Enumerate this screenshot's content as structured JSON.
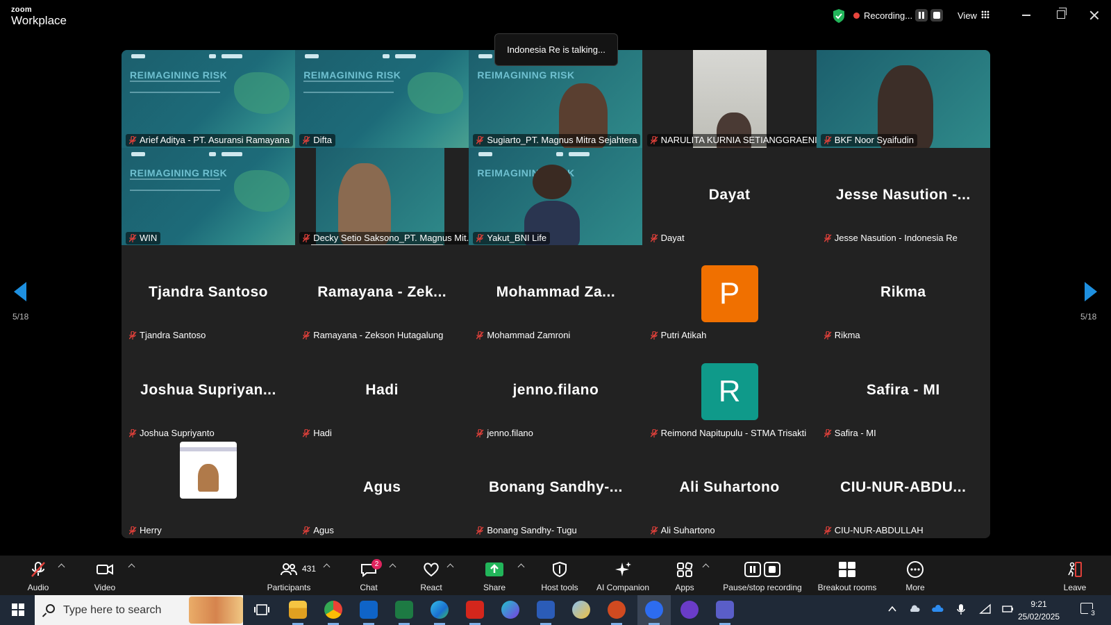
{
  "app": {
    "brand_top": "zoom",
    "brand_bottom": "Workplace"
  },
  "recording": {
    "label": "Recording..."
  },
  "view": {
    "label": "View"
  },
  "talking": "Indonesia Re is talking...",
  "nav": {
    "page": "5/18"
  },
  "slide": {
    "title": "REIMAGINING RISK"
  },
  "participants": [
    {
      "name": "Arief Aditya - PT. Asuransi Ramayana",
      "type": "slide"
    },
    {
      "name": "Difta",
      "type": "slide"
    },
    {
      "name": "Sugiarto_PT. Magnus Mitra Sejahtera",
      "type": "video"
    },
    {
      "name": "NARULITA KURNIA SETIANGGRAENI",
      "type": "video"
    },
    {
      "name": "BKF Noor Syaifudin",
      "type": "video"
    },
    {
      "name": "WIN",
      "type": "slide"
    },
    {
      "name": "Decky Setio Saksono_PT. Magnus Mit...",
      "type": "video",
      "active": true
    },
    {
      "name": "Yakut_BNI Life",
      "type": "video"
    },
    {
      "name": "Dayat",
      "display": "Dayat",
      "type": "name"
    },
    {
      "name": "Jesse Nasution - Indonesia Re",
      "display": "Jesse Nasution -...",
      "type": "name"
    },
    {
      "name": "Tjandra Santoso",
      "display": "Tjandra Santoso",
      "type": "name"
    },
    {
      "name": "Ramayana - Zekson Hutagalung",
      "display": "Ramayana - Zek...",
      "type": "name"
    },
    {
      "name": "Mohammad Zamroni",
      "display": "Mohammad Za...",
      "type": "name"
    },
    {
      "name": "Putri Atikah",
      "initial": "P",
      "color": "#f07000",
      "type": "avatar"
    },
    {
      "name": "Rikma",
      "display": "Rikma",
      "type": "name"
    },
    {
      "name": "Joshua Supriyanto",
      "display": "Joshua Supriyan...",
      "type": "name"
    },
    {
      "name": "Hadi",
      "display": "Hadi",
      "type": "name"
    },
    {
      "name": "jenno.filano",
      "display": "jenno.filano",
      "type": "name"
    },
    {
      "name": "Reimond Napitupulu - STMA Trisakti",
      "initial": "R",
      "color": "#0f9a8a",
      "type": "avatar"
    },
    {
      "name": "Safira - MI",
      "display": "Safira - MI",
      "type": "name"
    },
    {
      "name": "Herry",
      "type": "photo"
    },
    {
      "name": "Agus",
      "display": "Agus",
      "type": "name"
    },
    {
      "name": "Bonang Sandhy- Tugu",
      "display": "Bonang Sandhy-...",
      "type": "name"
    },
    {
      "name": "Ali Suhartono",
      "display": "Ali Suhartono",
      "type": "name"
    },
    {
      "name": "CIU-NUR-ABDULLAH",
      "display": "CIU-NUR-ABDU...",
      "type": "name"
    }
  ],
  "toolbar": {
    "audio": "Audio",
    "video": "Video",
    "participants": "Participants",
    "participants_count": "431",
    "chat": "Chat",
    "chat_badge": "2",
    "react": "React",
    "share": "Share",
    "host_tools": "Host tools",
    "ai_companion": "AI Companion",
    "apps": "Apps",
    "pause_recording": "Pause/stop recording",
    "breakout": "Breakout rooms",
    "more": "More",
    "leave": "Leave"
  },
  "taskbar": {
    "search_placeholder": "Type here to search",
    "time": "9:21",
    "date": "25/02/2025",
    "notifications": "3"
  },
  "colors": {
    "accent": "#1e90e0",
    "share": "#22b55a",
    "mic_off": "#e0403a"
  }
}
